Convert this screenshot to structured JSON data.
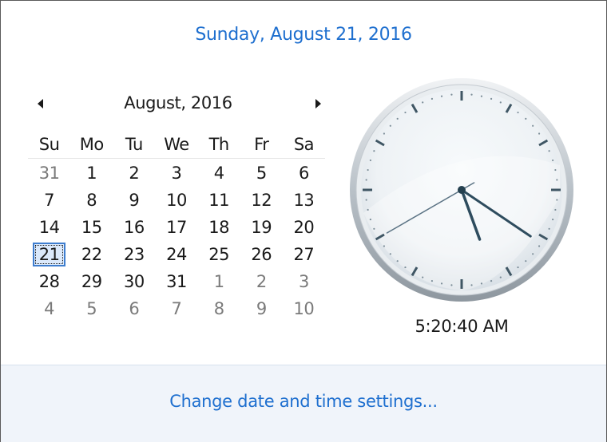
{
  "header": {
    "full_date": "Sunday, August 21, 2016"
  },
  "calendar": {
    "month_label": "August, 2016",
    "weekdays": [
      "Su",
      "Mo",
      "Tu",
      "We",
      "Th",
      "Fr",
      "Sa"
    ],
    "weeks": [
      [
        {
          "d": "31",
          "other": true
        },
        {
          "d": "1"
        },
        {
          "d": "2"
        },
        {
          "d": "3"
        },
        {
          "d": "4"
        },
        {
          "d": "5"
        },
        {
          "d": "6"
        }
      ],
      [
        {
          "d": "7"
        },
        {
          "d": "8"
        },
        {
          "d": "9"
        },
        {
          "d": "10"
        },
        {
          "d": "11"
        },
        {
          "d": "12"
        },
        {
          "d": "13"
        }
      ],
      [
        {
          "d": "14"
        },
        {
          "d": "15"
        },
        {
          "d": "16"
        },
        {
          "d": "17"
        },
        {
          "d": "18"
        },
        {
          "d": "19"
        },
        {
          "d": "20"
        }
      ],
      [
        {
          "d": "21",
          "today": true
        },
        {
          "d": "22"
        },
        {
          "d": "23"
        },
        {
          "d": "24"
        },
        {
          "d": "25"
        },
        {
          "d": "26"
        },
        {
          "d": "27"
        }
      ],
      [
        {
          "d": "28"
        },
        {
          "d": "29"
        },
        {
          "d": "30"
        },
        {
          "d": "31"
        },
        {
          "d": "1",
          "other": true
        },
        {
          "d": "2",
          "other": true
        },
        {
          "d": "3",
          "other": true
        }
      ],
      [
        {
          "d": "4",
          "other": true
        },
        {
          "d": "5",
          "other": true
        },
        {
          "d": "6",
          "other": true
        },
        {
          "d": "7",
          "other": true
        },
        {
          "d": "8",
          "other": true
        },
        {
          "d": "9",
          "other": true
        },
        {
          "d": "10",
          "other": true
        }
      ]
    ]
  },
  "clock": {
    "time_text": "5:20:40 AM",
    "hours": 5,
    "minutes": 20,
    "seconds": 40
  },
  "footer": {
    "link_label": "Change date and time settings..."
  },
  "colors": {
    "accent": "#1e6fcf",
    "today_border": "#3f7ecf",
    "footer_bg": "#f0f4fa"
  },
  "icons": {
    "prev": "chevron-left-icon",
    "next": "chevron-right-icon"
  }
}
